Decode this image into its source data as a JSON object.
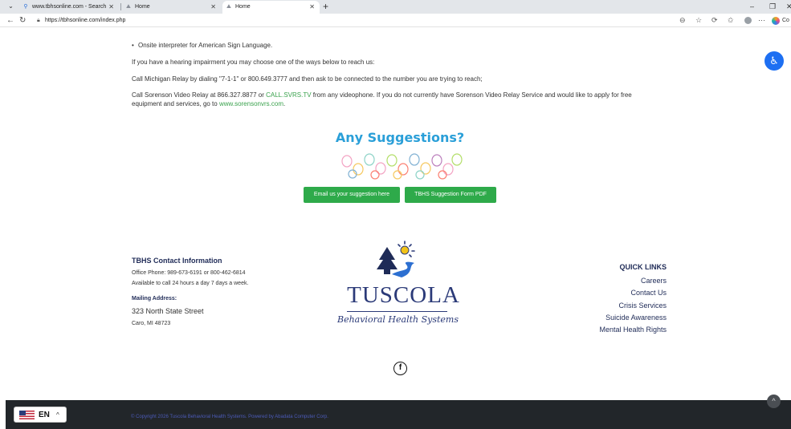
{
  "browser": {
    "tabs": [
      {
        "label": "www.tbhsonline.com - Search",
        "icon": "search-icon"
      },
      {
        "label": "Home",
        "icon": "site-icon"
      },
      {
        "label": "Home",
        "icon": "site-icon"
      }
    ],
    "url": "https://tbhsonline.com/index.php",
    "profile_label": "Co"
  },
  "content": {
    "bullet_text": "Onsite interpreter for American Sign Language.",
    "hearing_text": "If you have a hearing impairment you may choose one of the ways below to reach us:",
    "relay_text": "Call Michigan Relay by dialing \"7-1-1\" or 800.649.3777 and then ask to be connected to the number you are trying to reach;",
    "sorenson_pre": "Call Sorenson Video Relay at 866.327.8877 or ",
    "sorenson_link": "CALL.SVRS.TV",
    "sorenson_post": " from any videophone. If you do not currently have Sorenson Video Relay Service and would like to apply for free",
    "sorenson_line2_pre": "equipment and services, go to ",
    "sorenson_line2_link": "www.sorensonvrs.com",
    "sorenson_line2_post": "."
  },
  "suggestions": {
    "title": "Any Suggestions?",
    "email_button": "Email us your suggestion here",
    "pdf_button": "TBHS Suggestion Form PDF"
  },
  "contact": {
    "heading": "TBHS Contact Information",
    "phone": "Office Phone: 989-673-6191 or 800-462-6814",
    "availability": "Available to call 24 hours a day 7 days a week.",
    "mailing_heading": "Mailing Address:",
    "street": "323 North State Street",
    "city": "Caro, MI 48723"
  },
  "logo": {
    "name": "TUSCOLA",
    "subtitle": "Behavioral Health Systems"
  },
  "quick_links": {
    "title": "QUICK LINKS",
    "items": [
      "Careers",
      "Contact Us",
      "Crisis Services",
      "Suicide Awareness",
      "Mental Health Rights"
    ]
  },
  "footer": {
    "copyright": "© Copyright 2026 Tuscola Behavioral Health Systems. Powered by Abadata Computer Corp.",
    "language": "EN"
  },
  "colors": {
    "accent_blue": "#2a9fd8",
    "button_green": "#2eaa4a",
    "navy": "#1f2b57",
    "footer_bg": "#22262a"
  }
}
